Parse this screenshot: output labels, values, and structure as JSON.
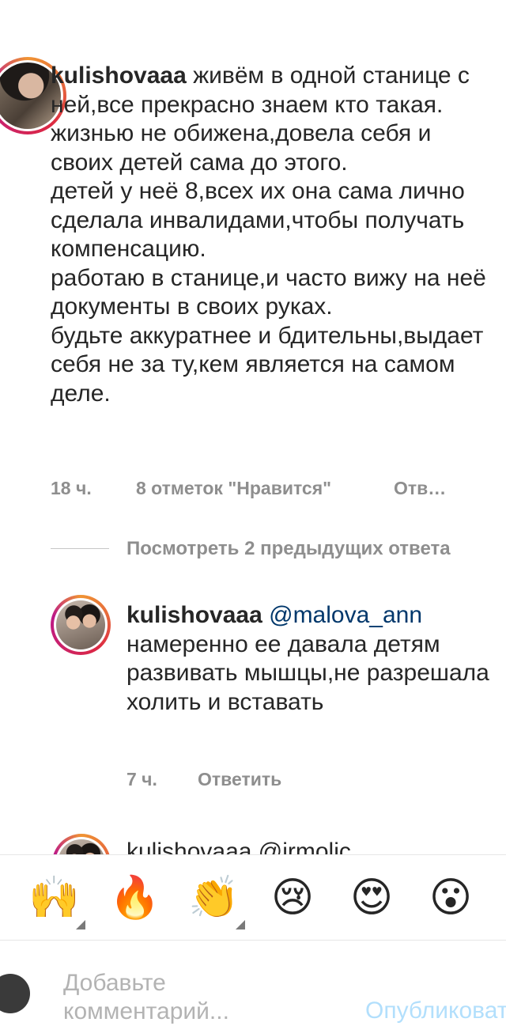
{
  "comments": [
    {
      "username": "kulishovaaa",
      "text": " живём в одной станице с ней,все прекрасно знаем кто такая.\nжизнью не обижена,довела себя и своих детей сама до этого.\nдетей у неё 8,всех их она сама лично сделала инвалидами,чтобы получать компенсацию.\nработаю в станице,и часто вижу на неё документы в своих руках.\nбудьте аккуратнее и бдительны,выдает себя не за ту,кем является на самом деле.",
      "time": "18 ч.",
      "likes": "8 отметок \"Нравится\"",
      "reply": "Отв…"
    }
  ],
  "view_replies": "Посмотреть 2 предыдущих ответа",
  "reply": {
    "username": "kulishovaaa",
    "mention": "@malova_ann",
    "text": "намеренно ее давала детям развивать мышцы,не разрешала холить и вставать",
    "time": "7 ч.",
    "reply": "Ответить"
  },
  "partial_comment": {
    "text": "kulishovaaa @irmolic"
  },
  "emoji_bar": {
    "items": [
      {
        "name": "raising-hands",
        "glyph": "🙌"
      },
      {
        "name": "fire",
        "glyph": "🔥"
      },
      {
        "name": "clapping-hands",
        "glyph": "👏"
      },
      {
        "name": "crying-face",
        "glyph": "😢"
      },
      {
        "name": "heart-eyes-face",
        "glyph": "😍"
      },
      {
        "name": "surprised-face",
        "glyph": "😮"
      }
    ]
  },
  "composer": {
    "placeholder": "Добавьте комментарий...",
    "publish": "Опубликовать"
  },
  "colors": {
    "text": "#262626",
    "secondary": "#8e8e8e",
    "mention": "#00376b",
    "publish_disabled": "#b2dffc"
  }
}
